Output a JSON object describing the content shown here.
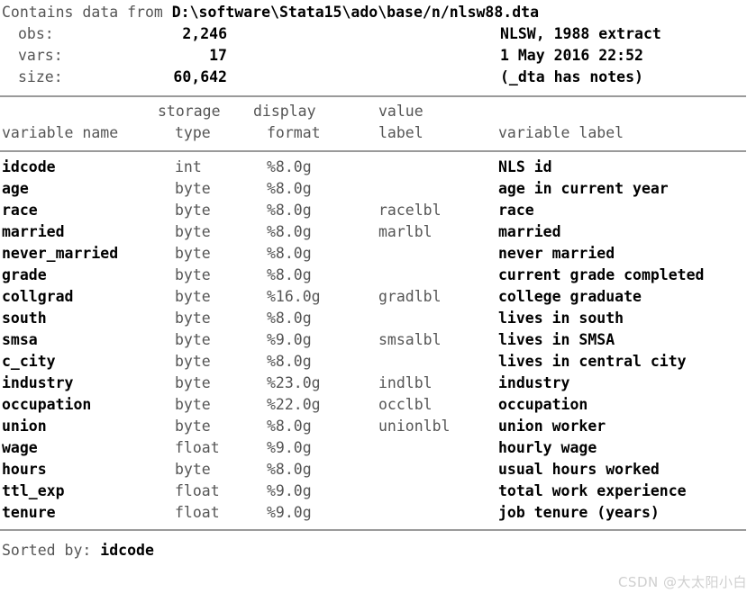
{
  "header": {
    "contains_prefix": "Contains data from ",
    "file_path": "D:\\software\\Stata15\\ado\\base/n/nlsw88.dta",
    "rows": [
      {
        "key": "obs:",
        "value": "2,246",
        "right": "NLSW, 1988 extract"
      },
      {
        "key": "vars:",
        "value": "17",
        "right": "1 May 2016 22:52"
      },
      {
        "key": "size:",
        "value": "60,642",
        "right": "(_dta has notes)"
      }
    ]
  },
  "columns": {
    "storage_line1": "storage",
    "display_line1": "display",
    "value_line1": "value",
    "variable_name": "variable name",
    "type": "type",
    "format": "format",
    "label": "label",
    "variable_label": "variable label"
  },
  "variables": [
    {
      "name": "idcode",
      "type": "int",
      "format": "%8.0g",
      "value_label": "",
      "label": "NLS id"
    },
    {
      "name": "age",
      "type": "byte",
      "format": "%8.0g",
      "value_label": "",
      "label": "age in current year"
    },
    {
      "name": "race",
      "type": "byte",
      "format": "%8.0g",
      "value_label": "racelbl",
      "label": "race"
    },
    {
      "name": "married",
      "type": "byte",
      "format": "%8.0g",
      "value_label": "marlbl",
      "label": "married"
    },
    {
      "name": "never_married",
      "type": "byte",
      "format": "%8.0g",
      "value_label": "",
      "label": "never married"
    },
    {
      "name": "grade",
      "type": "byte",
      "format": "%8.0g",
      "value_label": "",
      "label": "current grade completed"
    },
    {
      "name": "collgrad",
      "type": "byte",
      "format": "%16.0g",
      "value_label": "gradlbl",
      "label": "college graduate"
    },
    {
      "name": "south",
      "type": "byte",
      "format": "%8.0g",
      "value_label": "",
      "label": "lives in south"
    },
    {
      "name": "smsa",
      "type": "byte",
      "format": "%9.0g",
      "value_label": "smsalbl",
      "label": "lives in SMSA"
    },
    {
      "name": "c_city",
      "type": "byte",
      "format": "%8.0g",
      "value_label": "",
      "label": "lives in central city"
    },
    {
      "name": "industry",
      "type": "byte",
      "format": "%23.0g",
      "value_label": "indlbl",
      "label": "industry"
    },
    {
      "name": "occupation",
      "type": "byte",
      "format": "%22.0g",
      "value_label": "occlbl",
      "label": "occupation"
    },
    {
      "name": "union",
      "type": "byte",
      "format": "%8.0g",
      "value_label": "unionlbl",
      "label": "union worker"
    },
    {
      "name": "wage",
      "type": "float",
      "format": "%9.0g",
      "value_label": "",
      "label": "hourly wage"
    },
    {
      "name": "hours",
      "type": "byte",
      "format": "%8.0g",
      "value_label": "",
      "label": "usual hours worked"
    },
    {
      "name": "ttl_exp",
      "type": "float",
      "format": "%9.0g",
      "value_label": "",
      "label": "total work experience"
    },
    {
      "name": "tenure",
      "type": "float",
      "format": "%9.0g",
      "value_label": "",
      "label": "job tenure (years)"
    }
  ],
  "footer": {
    "sorted_by_label": "Sorted by: ",
    "sorted_by_value": "idcode"
  },
  "watermark": {
    "text": "CSDN @大太阳小白"
  },
  "colors": {
    "background": "#ffffff",
    "normal_text": "#555555",
    "bold_text": "#000000",
    "rule": "#9a9a9a",
    "watermark": "#cfcfcf"
  }
}
